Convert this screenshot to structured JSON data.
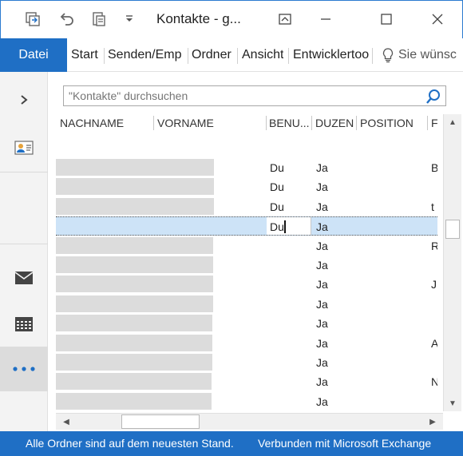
{
  "window": {
    "title": "Kontakte - g..."
  },
  "ribbon": {
    "tabs": [
      "Datei",
      "Start",
      "Senden/Emp",
      "Ordner",
      "Ansicht",
      "Entwicklertoo"
    ],
    "tell_me": "Sie wünsc"
  },
  "search": {
    "placeholder": "\"Kontakte\" durchsuchen"
  },
  "table": {
    "columns": [
      "NACHNAME",
      "VORNAME",
      "BENU...",
      "DUZEN",
      "POSITION",
      "F"
    ],
    "rows": [
      {
        "benu": "Du",
        "duzen": "Ja",
        "extra": "B",
        "name_width": 198
      },
      {
        "benu": "Du",
        "duzen": "Ja",
        "extra": "",
        "name_width": 198
      },
      {
        "benu": "Du",
        "duzen": "Ja",
        "extra": "t",
        "name_width": 198
      },
      {
        "benu": "Du",
        "duzen": "Ja",
        "extra": "",
        "name_width": 198,
        "selected": true
      },
      {
        "benu": "",
        "duzen": "Ja",
        "extra": "R",
        "name_width": 197
      },
      {
        "benu": "",
        "duzen": "Ja",
        "extra": "",
        "name_width": 197
      },
      {
        "benu": "",
        "duzen": "Ja",
        "extra": "J",
        "name_width": 197
      },
      {
        "benu": "",
        "duzen": "Ja",
        "extra": "",
        "name_width": 197
      },
      {
        "benu": "",
        "duzen": "Ja",
        "extra": "",
        "name_width": 196
      },
      {
        "benu": "",
        "duzen": "Ja",
        "extra": "A",
        "name_width": 196
      },
      {
        "benu": "",
        "duzen": "Ja",
        "extra": "",
        "name_width": 196
      },
      {
        "benu": "",
        "duzen": "Ja",
        "extra": "N",
        "name_width": 195
      },
      {
        "benu": "",
        "duzen": "Ja",
        "extra": "",
        "name_width": 195
      }
    ]
  },
  "status": {
    "left": "Alle Ordner sind auf dem neuesten Stand.",
    "right": "Verbunden mit Microsoft Exchange"
  },
  "colors": {
    "accent": "#1f6fc5",
    "selection": "#cde3f7"
  }
}
